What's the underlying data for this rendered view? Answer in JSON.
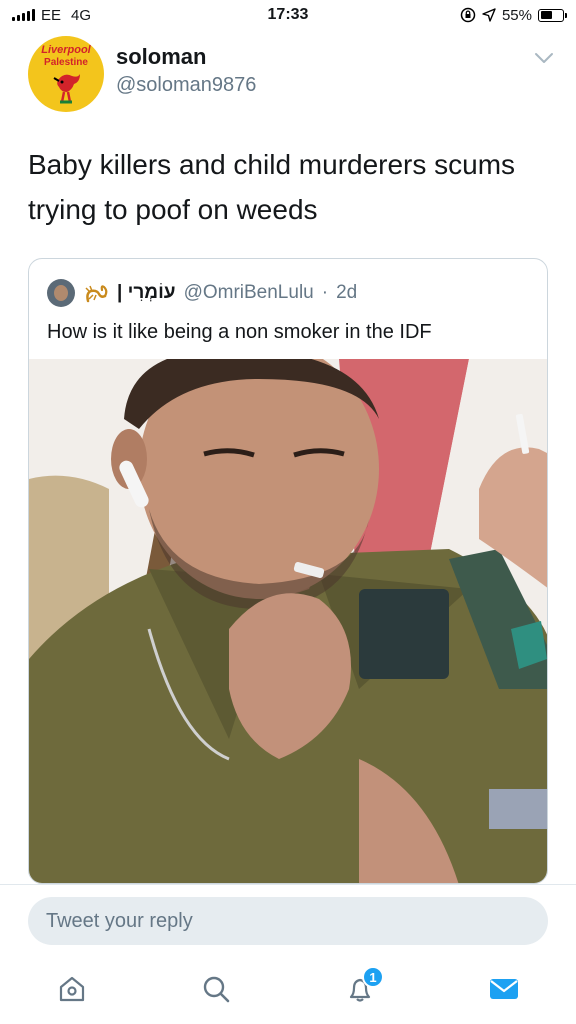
{
  "status_bar": {
    "carrier": "EE",
    "network": "4G",
    "time": "17:33",
    "battery": "55%",
    "battery_level": 0.55
  },
  "tweet": {
    "display_name": "soloman",
    "handle": "@soloman9876",
    "avatar_text_top": "Liverpool",
    "avatar_text_bottom": "Palestine",
    "text": "Baby killers and child murderers scums trying to poof on weeds"
  },
  "quote": {
    "display_name": "עוֹמְרִי |",
    "handle": "@OmriBenLulu",
    "separator": "·",
    "time_ago": "2d",
    "text": "How is it like being a non smoker in the IDF"
  },
  "reply": {
    "placeholder": "Tweet your reply"
  },
  "tab_bar": {
    "items": [
      {
        "icon": "home-icon"
      },
      {
        "icon": "search-icon"
      },
      {
        "icon": "notifications-icon",
        "badge": "1"
      },
      {
        "icon": "messages-icon"
      }
    ]
  },
  "colors": {
    "accent": "#1da1f2",
    "secondary_text": "#657786",
    "primary_text": "#14171a"
  }
}
